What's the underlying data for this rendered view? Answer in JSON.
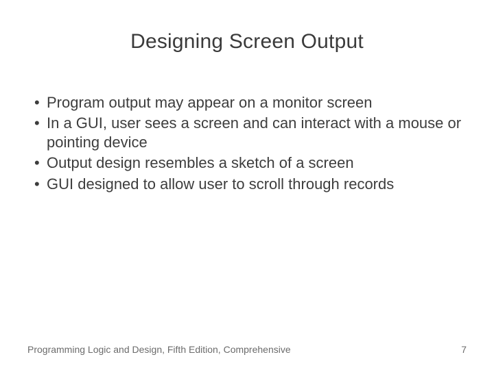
{
  "title": "Designing Screen Output",
  "bullets": [
    "Program output may appear on a monitor screen",
    "In a GUI, user sees a screen and can interact with a mouse or pointing device",
    "Output design resembles a sketch of a screen",
    "GUI designed to allow user to scroll through records"
  ],
  "footer": {
    "source": "Programming Logic and Design, Fifth Edition, Comprehensive",
    "page": "7"
  }
}
